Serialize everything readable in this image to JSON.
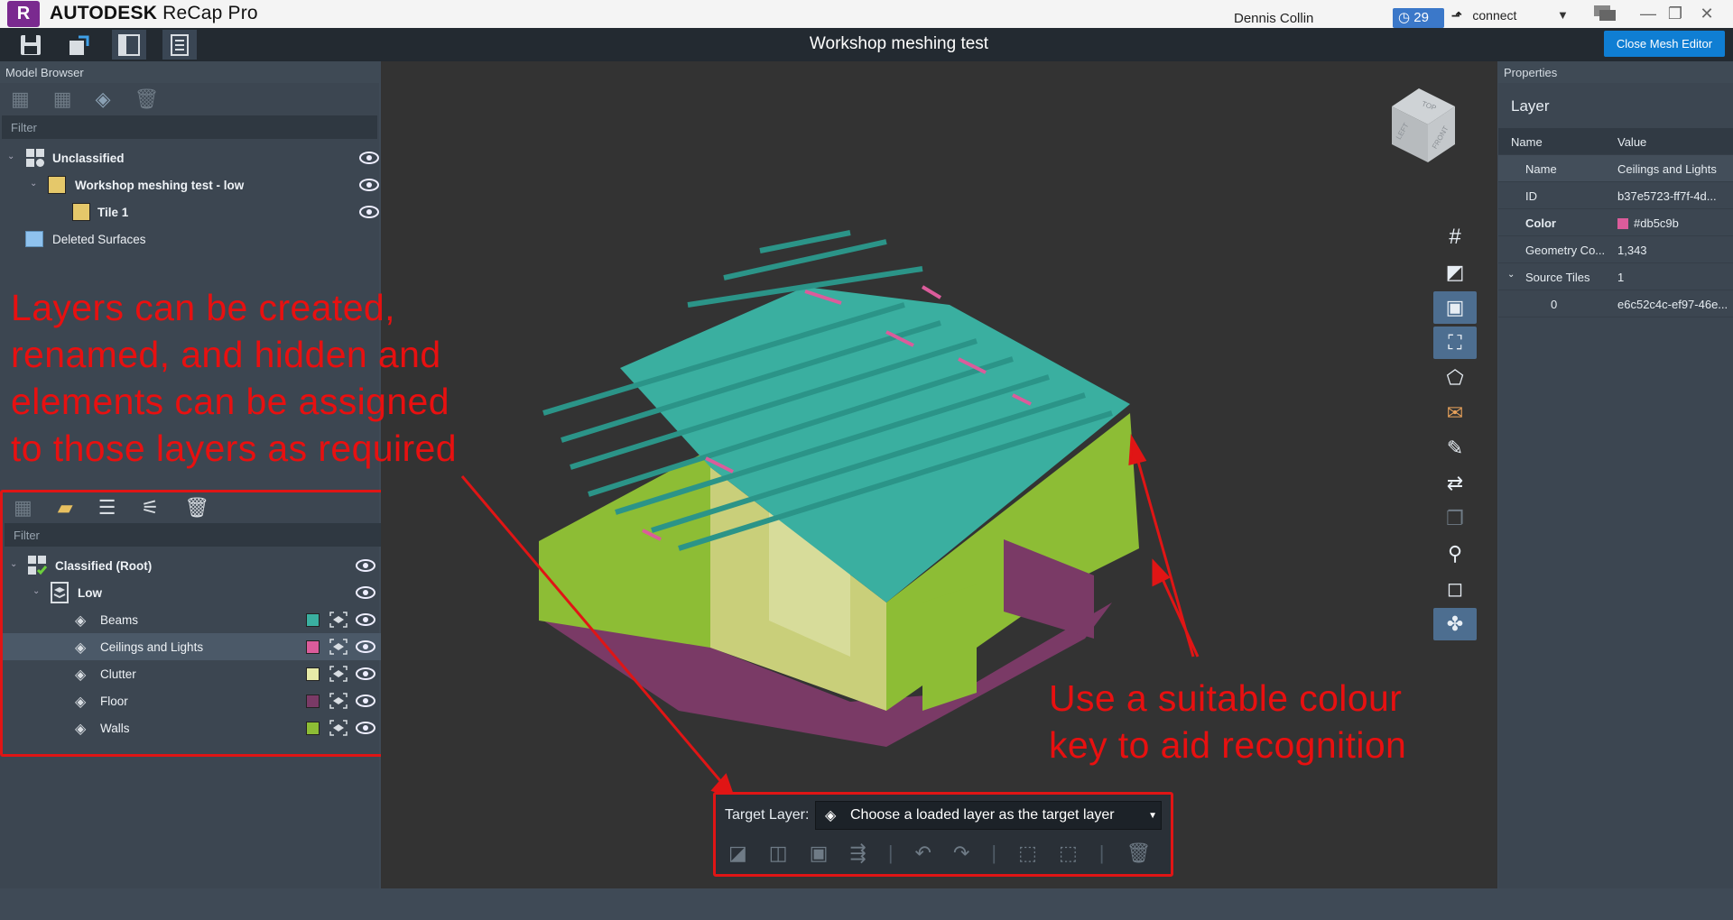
{
  "app": {
    "name": "ReCap Pro",
    "brand": "AUTODESK",
    "logo_letter": "R"
  },
  "titlebar": {
    "user": "Dennis Collin",
    "notifications": "29",
    "connect": "connect"
  },
  "doc": {
    "title": "Workshop meshing test",
    "close_button": "Close Mesh Editor"
  },
  "model_browser": {
    "header": "Model Browser",
    "filter_placeholder": "Filter",
    "items": [
      {
        "label": "Unclassified"
      },
      {
        "label": "Workshop meshing test - low"
      },
      {
        "label": "Tile 1"
      },
      {
        "label": "Deleted Surfaces"
      }
    ]
  },
  "layers": {
    "filter_placeholder": "Filter",
    "root": "Classified (Root)",
    "group": "Low",
    "items": [
      {
        "label": "Beams",
        "color": "#3aafa0"
      },
      {
        "label": "Ceilings and Lights",
        "color": "#db5c9b"
      },
      {
        "label": "Clutter",
        "color": "#e6eaa8"
      },
      {
        "label": "Floor",
        "color": "#7a3a66"
      },
      {
        "label": "Walls",
        "color": "#8dbd35"
      }
    ]
  },
  "properties": {
    "header": "Properties",
    "section": "Layer",
    "col_name": "Name",
    "col_value": "Value",
    "rows": [
      {
        "name": "Name",
        "value": "Ceilings and Lights"
      },
      {
        "name": "ID",
        "value": "b37e5723-ff7f-4d..."
      },
      {
        "name": "Color",
        "value": "#db5c9b"
      },
      {
        "name": "Geometry Co...",
        "value": "1,343"
      },
      {
        "name": "Source Tiles",
        "value": "1"
      },
      {
        "name": "0",
        "value": "e6c52c4c-ef97-46e..."
      }
    ]
  },
  "viewcube": {
    "top": "TOP",
    "left": "LEFT",
    "front": "FRONT"
  },
  "target": {
    "label": "Target Layer:",
    "placeholder": "Choose a loaded layer as the target layer"
  },
  "annotations": {
    "left": [
      "Layers can be created,",
      "renamed, and hidden and",
      "elements can be assigned",
      "to those layers as required"
    ],
    "right": [
      "Use a suitable colour",
      "key to aid recognition"
    ]
  },
  "colors": {
    "accent": "#0f7ed3",
    "annotation": "#e01515",
    "beams": "#3aafa0",
    "walls": "#8dbd35"
  }
}
